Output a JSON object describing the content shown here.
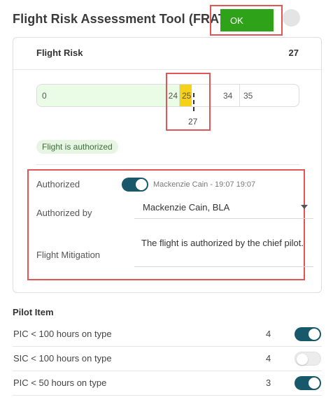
{
  "header": {
    "title": "Flight Risk Assessment Tool (FRAT)",
    "status_button": "OK",
    "status_color": "#2ea31a"
  },
  "flight_risk": {
    "label": "Flight Risk",
    "value": "27",
    "scale": {
      "ticks": [
        "0",
        "24",
        "25",
        "34",
        "35"
      ],
      "marker_value": "27",
      "colors": {
        "green": "#eafbe6",
        "yellow": "#f7d117"
      }
    },
    "status_text": "Flight is authorized"
  },
  "authorization": {
    "authorized_label": "Authorized",
    "authorized_on": true,
    "authorized_meta": "Mackenzie Cain - 19:07 19:07",
    "authorized_by_label": "Authorized by",
    "authorized_by_value": "Mackenzie Cain, BLA",
    "mitigation_label": "Flight Mitigation",
    "mitigation_text": "The flight is authorized by the chief pilot."
  },
  "pilot_items": {
    "title": "Pilot Item",
    "items": [
      {
        "label": "PIC < 100 hours on type",
        "points": "4",
        "on": true
      },
      {
        "label": "SIC < 100 hours on type",
        "points": "4",
        "on": false
      },
      {
        "label": "PIC < 50 hours on type",
        "points": "3",
        "on": true
      }
    ]
  },
  "colors": {
    "accent": "#17586b",
    "highlight_border": "#e05555"
  }
}
